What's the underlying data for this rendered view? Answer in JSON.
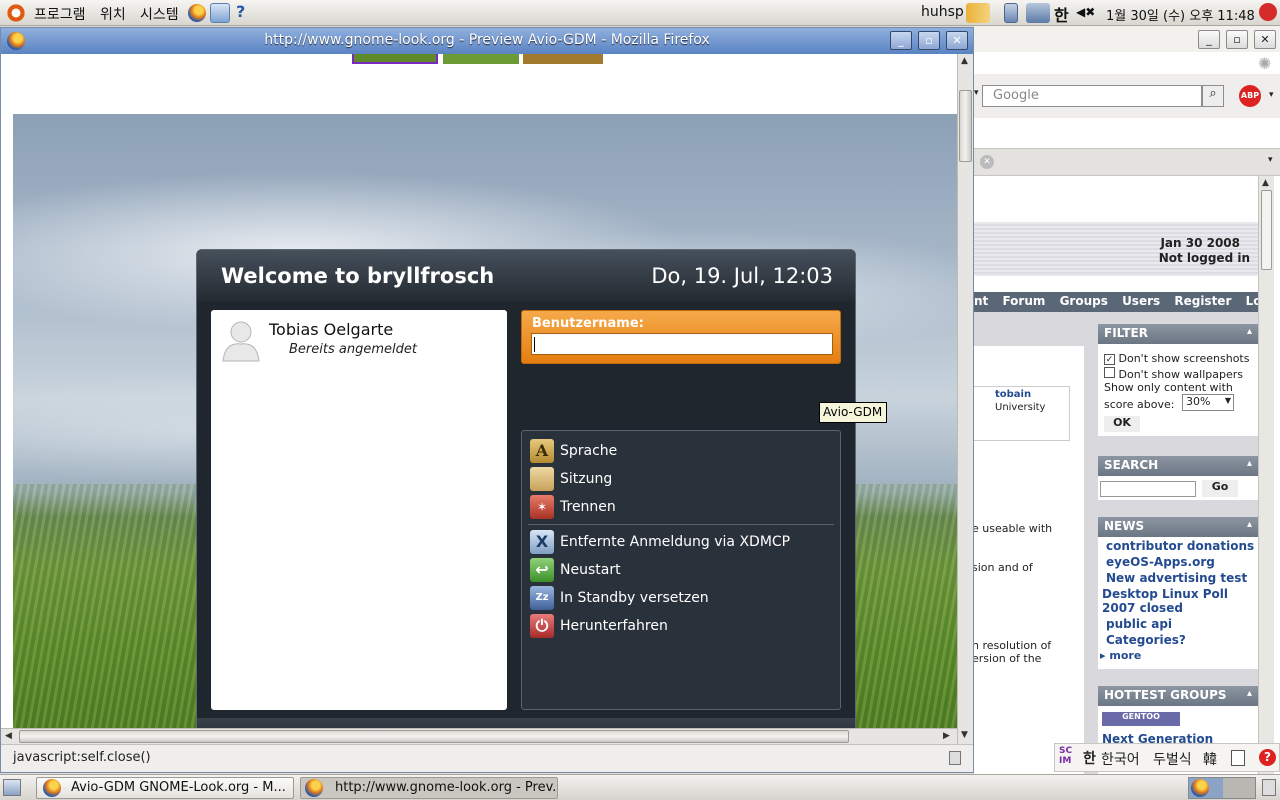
{
  "top_panel": {
    "menus": [
      "프로그램",
      "위치",
      "시스템"
    ],
    "user": "huhsp",
    "ime_indicator": "한",
    "clock": "1월 30일 (수) 오후 11:48"
  },
  "front_window": {
    "title": "http://www.gnome-look.org - Preview Avio-GDM - Mozilla Firefox",
    "status_text": "javascript:self.close()"
  },
  "gdm": {
    "welcome": "Welcome to bryllfrosch",
    "clock": "Do, 19. Jul, 12:03",
    "user_name": "Tobias Oelgarte",
    "user_status": "Bereits angemeldet",
    "username_label": "Benutzername:",
    "tooltip": "Avio-GDM",
    "menu_top": [
      "Sprache",
      "Sitzung",
      "Trennen"
    ],
    "menu_bottom": [
      "Entfernte Anmeldung via XDMCP",
      "Neustart",
      "In Standby versetzen",
      "Herunterfahren"
    ]
  },
  "back_window": {
    "search_placeholder": "Google",
    "abp": "ABP",
    "date": "Jan 30 2008",
    "login_state": "Not logged in",
    "nav": [
      "nt",
      "Forum",
      "Groups",
      "Users",
      "Register",
      "Login"
    ],
    "card_user": "tobain",
    "card_sub": "University",
    "snippets": [
      "e useable with",
      "sion and of",
      "n resolution of",
      "ersion of the"
    ],
    "filter": {
      "title": "FILTER",
      "opt1": "Don't show screenshots",
      "opt2": "Don't show wallpapers",
      "score_text1": "Show only content with",
      "score_text2": "score above:",
      "score_value": "30%",
      "ok": "OK"
    },
    "search": {
      "title": "SEARCH",
      "go": "Go"
    },
    "news": {
      "title": "NEWS",
      "items": [
        "contributor donations",
        "eyeOS-Apps.org",
        "New advertising test",
        "Desktop Linux Poll 2007 closed",
        "public api",
        "Categories?"
      ],
      "more": "more"
    },
    "hottest": {
      "title": "HOTTEST GROUPS",
      "badge": "GENTOO",
      "next": "Next Generation"
    }
  },
  "ime": {
    "han": "한",
    "lang": "한국어",
    "method": "두벌식",
    "hanja": "韓"
  },
  "taskbar": {
    "tasks": [
      "Avio-GDM GNOME-Look.org - M...",
      "http://www.gnome-look.org - Prev..."
    ]
  }
}
